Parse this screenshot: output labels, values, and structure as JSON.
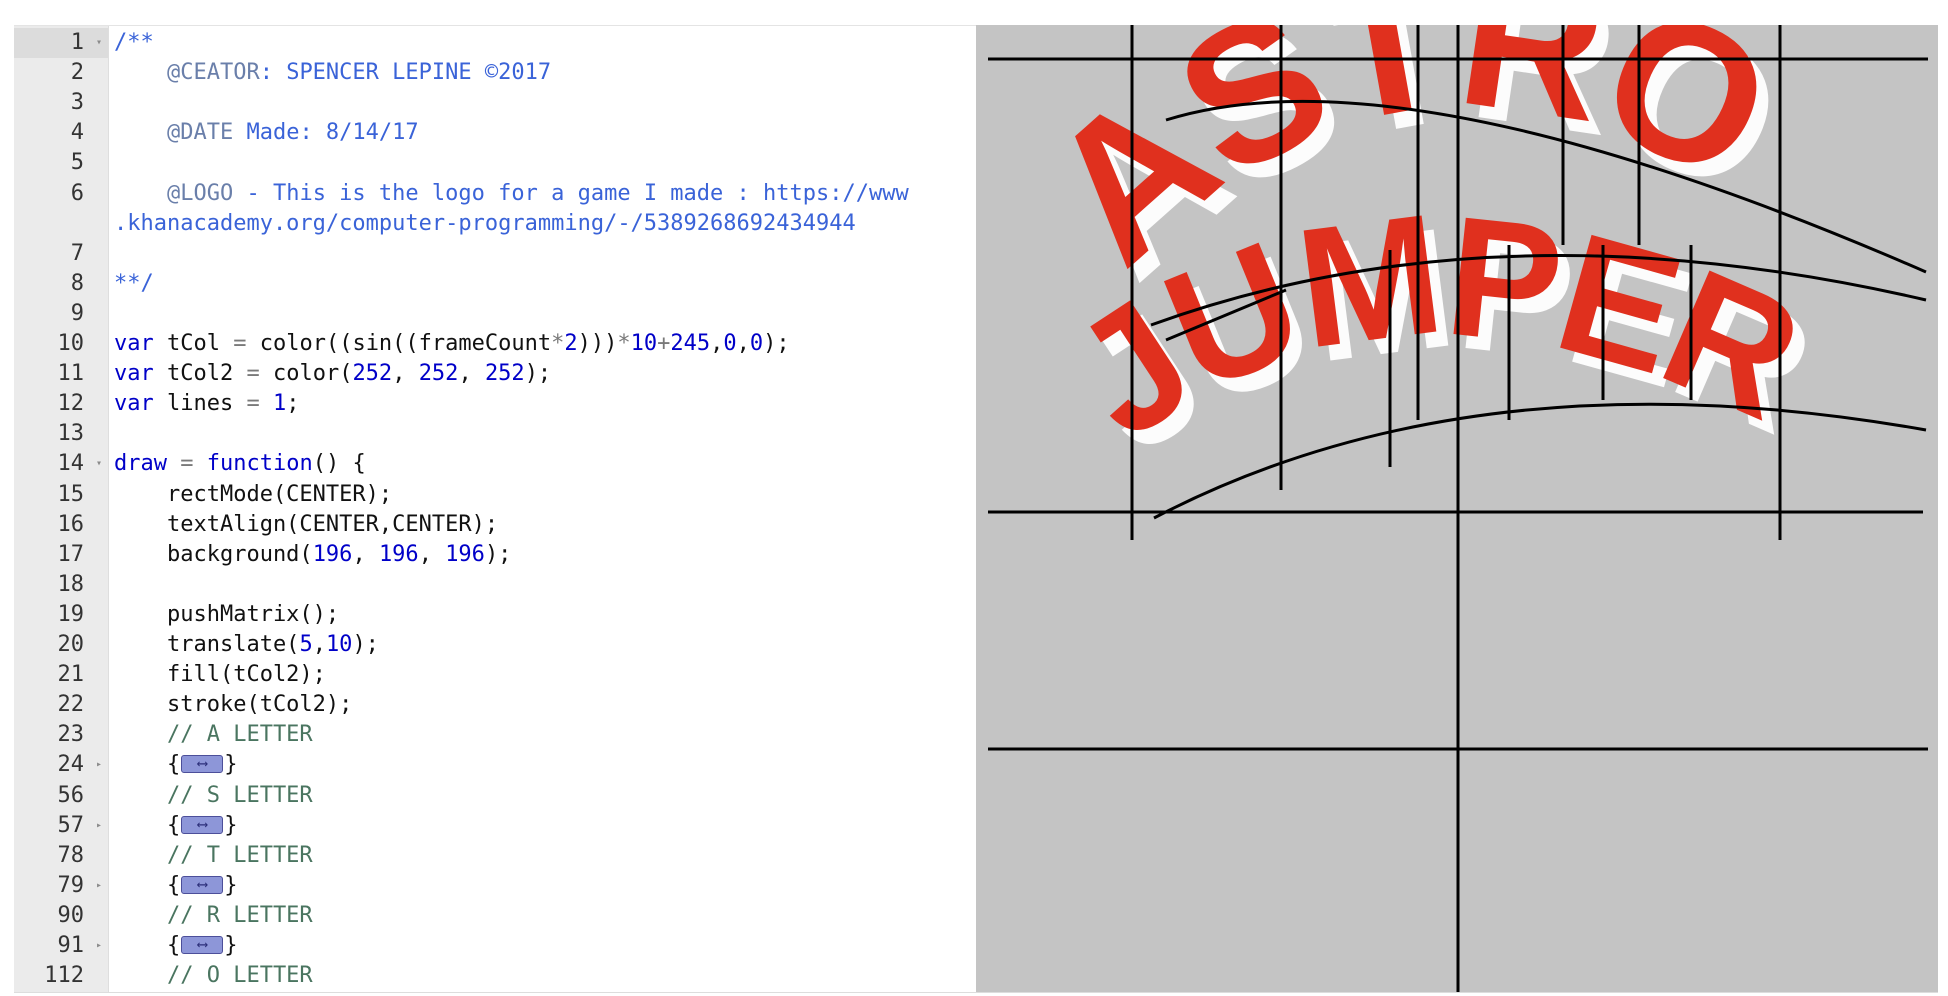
{
  "editor": {
    "colors": {
      "comment": "#3a63d8",
      "keyword": "#0000c8",
      "number": "#0000c8",
      "operator": "#7a7a7a",
      "doc_tag": "#6a7faa",
      "line_comment": "#4a7560",
      "text": "#111111"
    },
    "lines": [
      {
        "no": "1",
        "fold": "open",
        "active": true,
        "segments": [
          [
            "comment",
            "/**"
          ]
        ]
      },
      {
        "no": "2",
        "segments": [
          [
            "doc_tag",
            "    @CEATOR"
          ],
          [
            "comment",
            ": SPENCER LEPINE ©2017"
          ]
        ]
      },
      {
        "no": "3",
        "segments": []
      },
      {
        "no": "4",
        "segments": [
          [
            "doc_tag",
            "    @DATE"
          ],
          [
            "comment",
            " Made: 8/14/17"
          ]
        ]
      },
      {
        "no": "5",
        "segments": []
      },
      {
        "no": "6",
        "segments": [
          [
            "doc_tag",
            "    @LOGO"
          ],
          [
            "comment",
            " - This is the logo for a game I made : https://www"
          ]
        ]
      },
      {
        "no": "",
        "segments": [
          [
            "comment",
            ".khanacademy.org/computer-programming/-/5389268692434944"
          ]
        ]
      },
      {
        "no": "7",
        "segments": []
      },
      {
        "no": "8",
        "segments": [
          [
            "comment",
            "**/"
          ]
        ]
      },
      {
        "no": "9",
        "segments": []
      },
      {
        "no": "10",
        "segments": [
          [
            "keyword",
            "var"
          ],
          [
            "text",
            " tCol "
          ],
          [
            "operator",
            "="
          ],
          [
            "text",
            " color((sin((frameCount"
          ],
          [
            "operator",
            "*"
          ],
          [
            "number",
            "2"
          ],
          [
            "text",
            ")))"
          ],
          [
            "operator",
            "*"
          ],
          [
            "number",
            "10"
          ],
          [
            "operator",
            "+"
          ],
          [
            "number",
            "245"
          ],
          [
            "text",
            ","
          ],
          [
            "number",
            "0"
          ],
          [
            "text",
            ","
          ],
          [
            "number",
            "0"
          ],
          [
            "text",
            ");"
          ]
        ]
      },
      {
        "no": "11",
        "segments": [
          [
            "keyword",
            "var"
          ],
          [
            "text",
            " tCol2 "
          ],
          [
            "operator",
            "="
          ],
          [
            "text",
            " color("
          ],
          [
            "number",
            "252"
          ],
          [
            "text",
            ", "
          ],
          [
            "number",
            "252"
          ],
          [
            "text",
            ", "
          ],
          [
            "number",
            "252"
          ],
          [
            "text",
            ");"
          ]
        ]
      },
      {
        "no": "12",
        "segments": [
          [
            "keyword",
            "var"
          ],
          [
            "text",
            " lines "
          ],
          [
            "operator",
            "="
          ],
          [
            "text",
            " "
          ],
          [
            "number",
            "1"
          ],
          [
            "text",
            ";"
          ]
        ]
      },
      {
        "no": "13",
        "segments": []
      },
      {
        "no": "14",
        "fold": "open",
        "segments": [
          [
            "keyword",
            "draw"
          ],
          [
            "text",
            " "
          ],
          [
            "operator",
            "="
          ],
          [
            "text",
            " "
          ],
          [
            "keyword",
            "function"
          ],
          [
            "text",
            "() {"
          ]
        ]
      },
      {
        "no": "15",
        "segments": [
          [
            "text",
            "    rectMode(CENTER);"
          ]
        ]
      },
      {
        "no": "16",
        "segments": [
          [
            "text",
            "    textAlign(CENTER,CENTER);"
          ]
        ]
      },
      {
        "no": "17",
        "segments": [
          [
            "text",
            "    background("
          ],
          [
            "number",
            "196"
          ],
          [
            "text",
            ", "
          ],
          [
            "number",
            "196"
          ],
          [
            "text",
            ", "
          ],
          [
            "number",
            "196"
          ],
          [
            "text",
            ");"
          ]
        ]
      },
      {
        "no": "18",
        "segments": []
      },
      {
        "no": "19",
        "segments": [
          [
            "text",
            "    pushMatrix();"
          ]
        ]
      },
      {
        "no": "20",
        "segments": [
          [
            "text",
            "    translate("
          ],
          [
            "number",
            "5"
          ],
          [
            "text",
            ","
          ],
          [
            "number",
            "10"
          ],
          [
            "text",
            ");"
          ]
        ]
      },
      {
        "no": "21",
        "segments": [
          [
            "text",
            "    fill(tCol2);"
          ]
        ]
      },
      {
        "no": "22",
        "segments": [
          [
            "text",
            "    stroke(tCol2);"
          ]
        ]
      },
      {
        "no": "23",
        "segments": [
          [
            "line_comment",
            "    // A LETTER"
          ]
        ]
      },
      {
        "no": "24",
        "fold": "closed",
        "segments": [
          [
            "text",
            "    {"
          ],
          [
            "widget",
            ""
          ],
          [
            "text",
            "}"
          ]
        ]
      },
      {
        "no": "56",
        "segments": [
          [
            "line_comment",
            "    // S LETTER"
          ]
        ]
      },
      {
        "no": "57",
        "fold": "closed",
        "segments": [
          [
            "text",
            "    {"
          ],
          [
            "widget",
            ""
          ],
          [
            "text",
            "}"
          ]
        ]
      },
      {
        "no": "78",
        "segments": [
          [
            "line_comment",
            "    // T LETTER"
          ]
        ]
      },
      {
        "no": "79",
        "fold": "closed",
        "segments": [
          [
            "text",
            "    {"
          ],
          [
            "widget",
            ""
          ],
          [
            "text",
            "}"
          ]
        ]
      },
      {
        "no": "90",
        "segments": [
          [
            "line_comment",
            "    // R LETTER"
          ]
        ]
      },
      {
        "no": "91",
        "fold": "closed",
        "segments": [
          [
            "text",
            "    {"
          ],
          [
            "widget",
            ""
          ],
          [
            "text",
            "}"
          ]
        ]
      },
      {
        "no": "112",
        "segments": [
          [
            "line_comment",
            "    // O LETTER"
          ]
        ]
      }
    ]
  },
  "canvas": {
    "background": "#c4c4c4",
    "logo_top": "ASTRO",
    "logo_bottom": "JUMPER",
    "logo_fill": "#e0301e",
    "logo_shadow": "#fcfcfc",
    "guide_color": "#000000"
  }
}
